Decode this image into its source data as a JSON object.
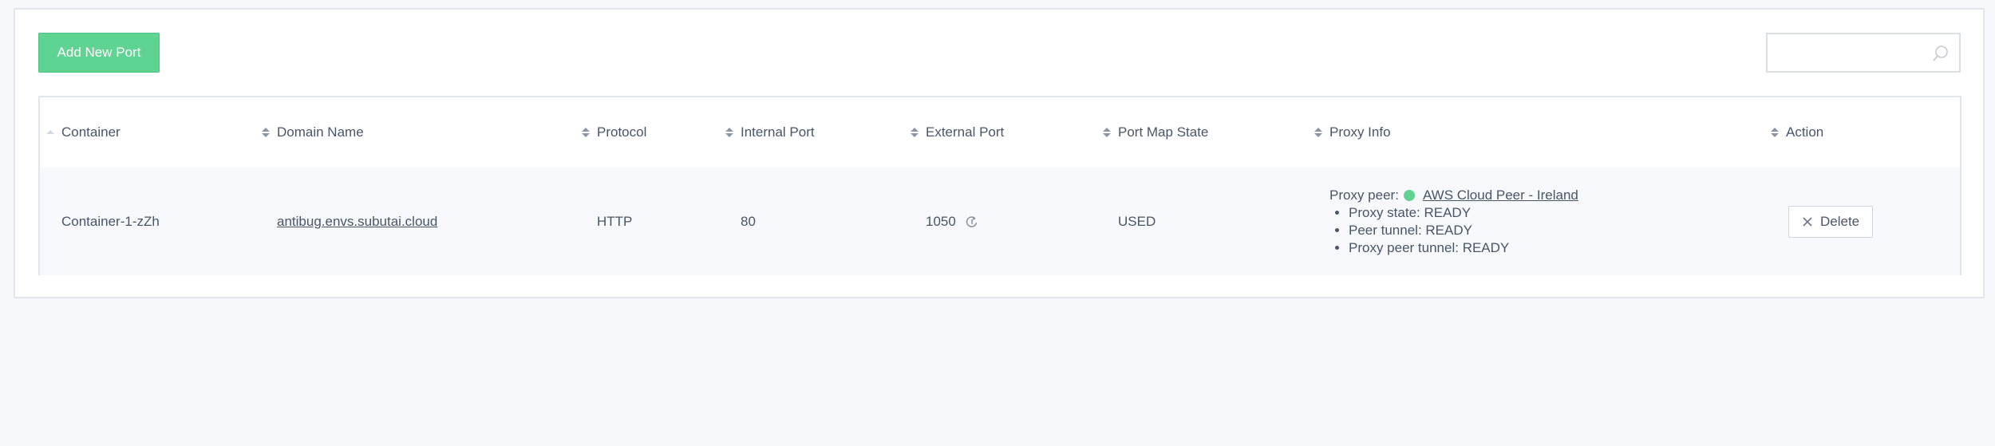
{
  "toolbar": {
    "add_label": "Add New Port",
    "search_value": "",
    "search_placeholder": ""
  },
  "table": {
    "columns": [
      {
        "label": "Container"
      },
      {
        "label": "Domain Name"
      },
      {
        "label": "Protocol"
      },
      {
        "label": "Internal Port"
      },
      {
        "label": "External Port"
      },
      {
        "label": "Port Map State"
      },
      {
        "label": "Proxy Info"
      },
      {
        "label": "Action"
      }
    ],
    "rows": [
      {
        "container": "Container-1-zZh",
        "domain": "antibug.envs.subutai.cloud",
        "protocol": "HTTP",
        "internal_port": "80",
        "external_port": "1050",
        "state": "USED",
        "proxy": {
          "peer_label": "Proxy peer:",
          "peer_name": "AWS Cloud Peer - Ireland",
          "details": [
            "Proxy state: READY",
            "Peer tunnel: READY",
            "Proxy peer tunnel: READY"
          ]
        },
        "action_label": "Delete"
      }
    ]
  },
  "colors": {
    "accent": "#5fd492",
    "text": "#4a5568",
    "row_bg": "#f7f9fc",
    "page_bg": "#f6f8fb"
  },
  "icons": {
    "search": "search-icon",
    "sort": "sort-icon",
    "refresh": "refresh-icon",
    "status": "status-dot-icon",
    "close": "close-icon"
  }
}
